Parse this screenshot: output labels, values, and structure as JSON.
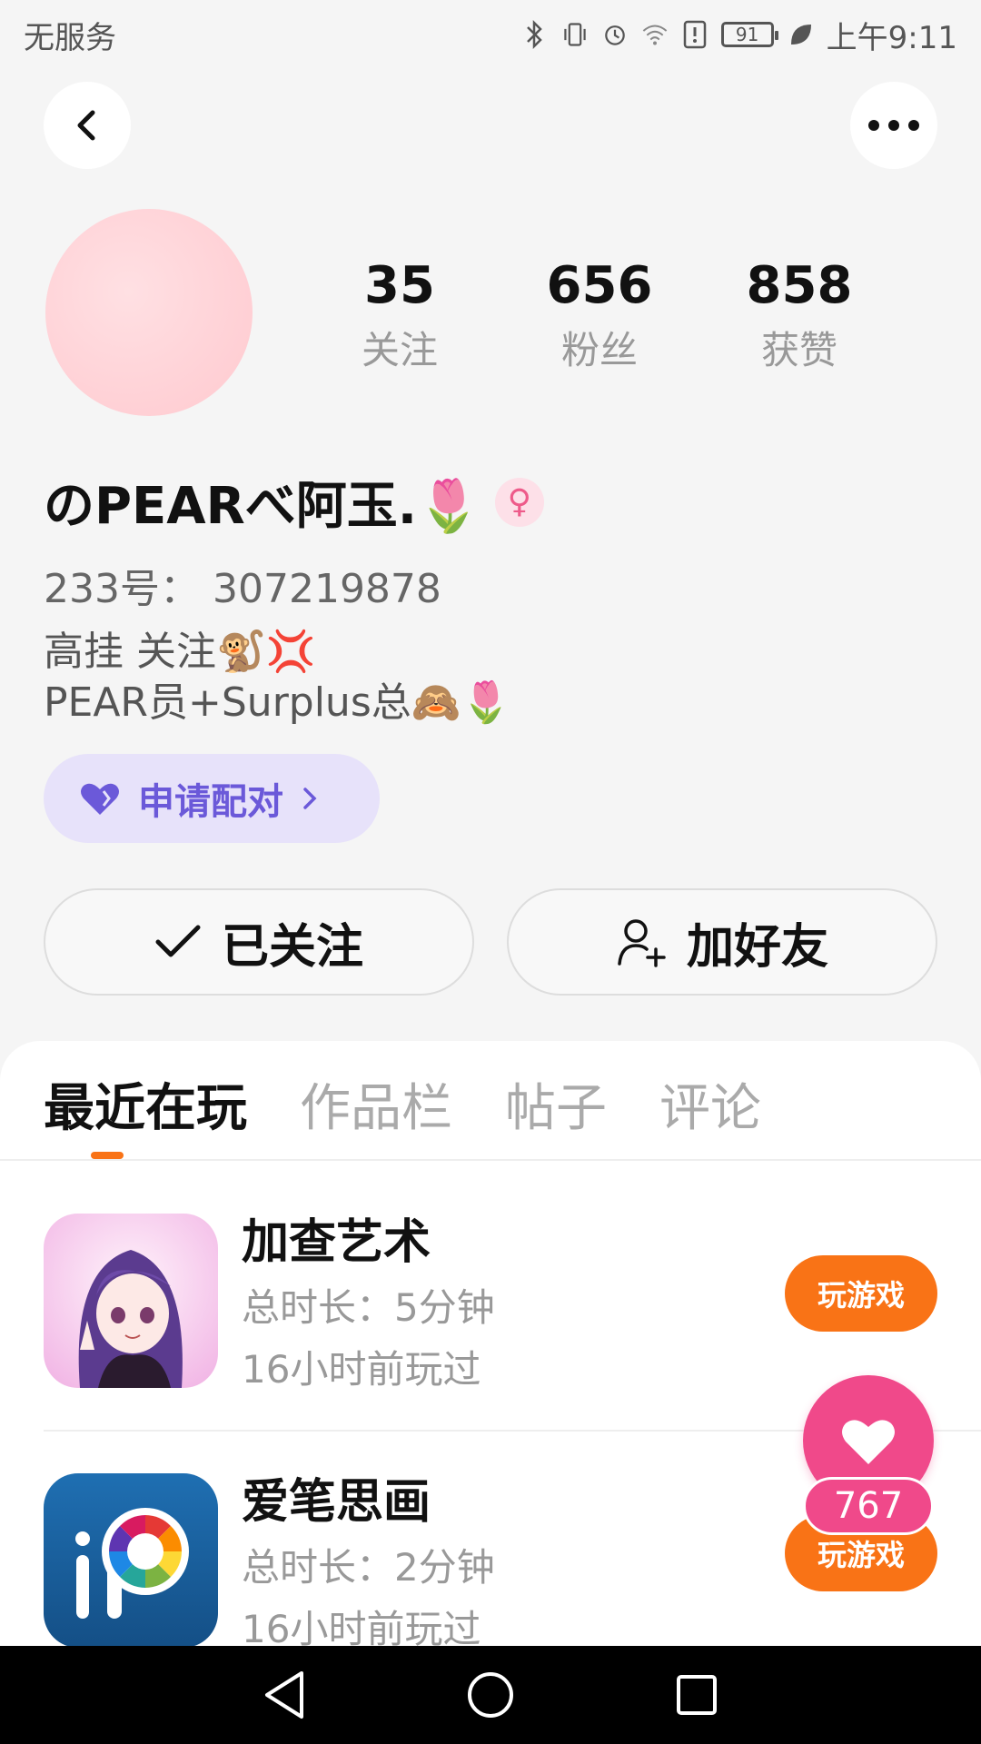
{
  "status_bar": {
    "carrier": "无服务",
    "battery": "91",
    "time": "上午9:11"
  },
  "profile": {
    "stats": [
      {
        "value": "35",
        "label": "关注"
      },
      {
        "value": "656",
        "label": "粉丝"
      },
      {
        "value": "858",
        "label": "获赞"
      }
    ],
    "username": "のPEARべ阿玉.🌷",
    "gender_symbol": "♀",
    "uid": "233号： 307219878",
    "bio": "高挂 关注🐒💢\nPEAR员+Surplus总🙈🌷",
    "match_label": "申请配对",
    "follow_label": "已关注",
    "add_friend_label": "加好友"
  },
  "tabs": [
    {
      "label": "最近在玩",
      "active": true
    },
    {
      "label": "作品栏",
      "active": false
    },
    {
      "label": "帖子",
      "active": false
    },
    {
      "label": "评论",
      "active": false
    }
  ],
  "games": [
    {
      "title": "加查艺术",
      "duration": "总时长：5分钟",
      "last_played": "16小时前玩过",
      "play_label": "玩游戏"
    },
    {
      "title": "爱笔思画",
      "duration": "总时长：2分钟",
      "last_played": "16小时前玩过",
      "play_label": "玩游戏"
    }
  ],
  "like_float": {
    "count": "767"
  },
  "colors": {
    "accent_orange": "#f97316",
    "like_pink": "#f0498a",
    "match_purple": "#6b59d9"
  }
}
